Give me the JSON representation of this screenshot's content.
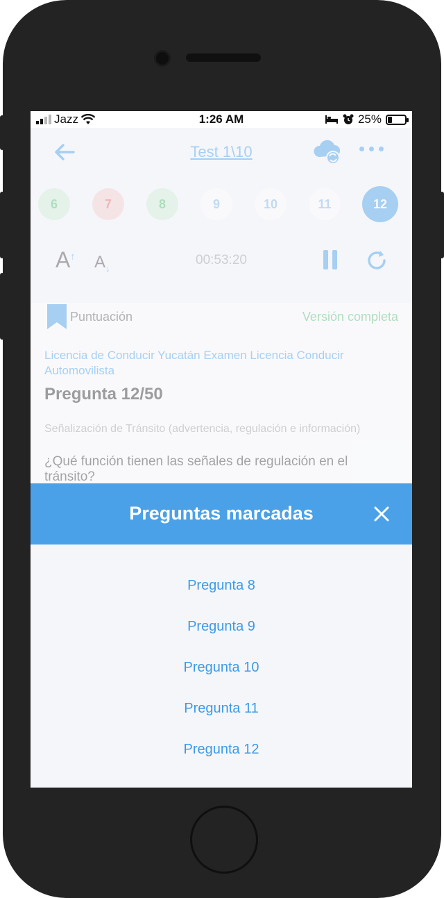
{
  "status": {
    "carrier": "Jazz",
    "time": "1:26 AM",
    "battery": "25%",
    "battery_level": 0.25
  },
  "nav": {
    "title": "Test 1\\10"
  },
  "question_numbers": [
    {
      "label": "6",
      "state": "correct"
    },
    {
      "label": "7",
      "state": "wrong"
    },
    {
      "label": "8",
      "state": "correct"
    },
    {
      "label": "9",
      "state": "unanswered"
    },
    {
      "label": "10",
      "state": "unanswered"
    },
    {
      "label": "11",
      "state": "unanswered"
    },
    {
      "label": "12",
      "state": "current"
    }
  ],
  "tools": {
    "font_up": "A",
    "font_down": "A",
    "timer": "00:53:20"
  },
  "card": {
    "score_label": "Puntuación",
    "full_version": "Versión completa",
    "category": "Licencia de Conducir Yucatán Examen Licencia Conducir Automovilista",
    "question_counter": "Pregunta 12/50",
    "subcategory": "Señalización de Tránsito (advertencia, regulación e información)",
    "question_text": "¿Qué función tienen las señales de regulación en el tránsito?"
  },
  "modal": {
    "title": "Preguntas marcadas",
    "items": [
      "Pregunta 8",
      "Pregunta 9",
      "Pregunta 10",
      "Pregunta 11",
      "Pregunta 12"
    ]
  },
  "colors": {
    "accent": "#3c9ae8",
    "modal_header": "#4aa1e8",
    "correct": "#4fbf6d",
    "wrong": "#e06161"
  }
}
